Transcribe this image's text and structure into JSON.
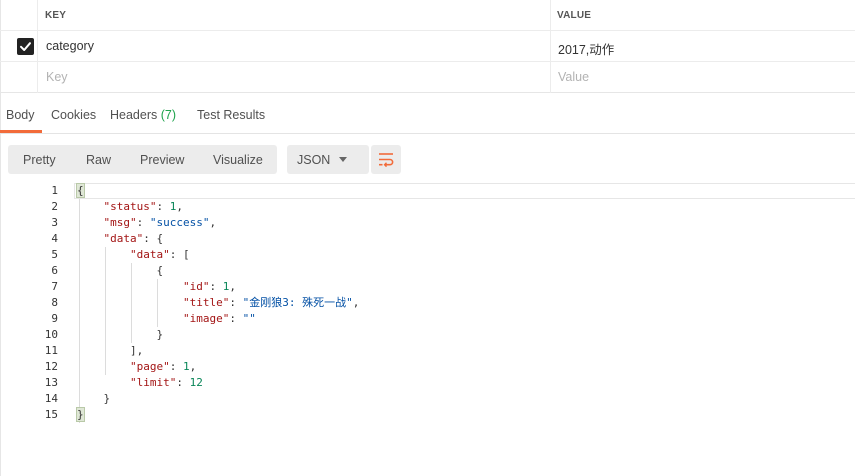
{
  "params_table": {
    "headers": {
      "key": "KEY",
      "value": "VALUE"
    },
    "rows": [
      {
        "checked": true,
        "key": "category",
        "value": "2017,动作"
      }
    ],
    "placeholder": {
      "key": "Key",
      "value": "Value"
    }
  },
  "response_tabs": [
    {
      "label": "Body",
      "active": true
    },
    {
      "label": "Cookies"
    },
    {
      "label": "Headers",
      "count": "(7)"
    },
    {
      "label": "Test Results"
    }
  ],
  "toolbar": {
    "formats": [
      "Pretty",
      "Raw",
      "Preview",
      "Visualize"
    ],
    "active_format": "Pretty",
    "language": "JSON",
    "wrap_icon": "wrap-lines-icon"
  },
  "editor": {
    "line_numbers": [
      "1",
      "2",
      "3",
      "4",
      "5",
      "6",
      "7",
      "8",
      "9",
      "10",
      "11",
      "12",
      "13",
      "14",
      "15"
    ],
    "lines": [
      {
        "t": "{"
      },
      {
        "k": "\"status\"",
        "v": "1",
        "vt": "n",
        "tail": ","
      },
      {
        "k": "\"msg\"",
        "v": "\"success\"",
        "vt": "s",
        "tail": ","
      },
      {
        "k": "\"data\"",
        "open": "{"
      },
      {
        "k": "\"data\"",
        "open": "["
      },
      {
        "t": "{"
      },
      {
        "k": "\"id\"",
        "v": "1",
        "vt": "n",
        "tail": ","
      },
      {
        "k": "\"title\"",
        "v": "\"金刚狼3: 殊死一战\"",
        "vt": "s",
        "tail": ","
      },
      {
        "k": "\"image\"",
        "v": "\"\"",
        "vt": "s"
      },
      {
        "t": "}"
      },
      {
        "t": "],"
      },
      {
        "k": "\"page\"",
        "v": "1",
        "vt": "n",
        "tail": ","
      },
      {
        "k": "\"limit\"",
        "v": "12",
        "vt": "n"
      },
      {
        "t": "}"
      },
      {
        "t": "}"
      }
    ]
  },
  "colors": {
    "accent": "#f26b3a",
    "count_green": "#1ea34c",
    "json_key": "#a31515",
    "json_string": "#0451a5",
    "json_number": "#098658"
  }
}
